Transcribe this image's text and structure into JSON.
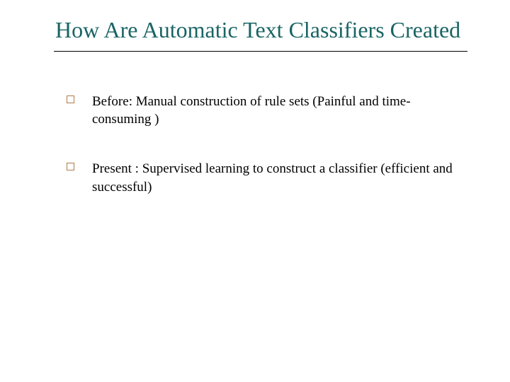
{
  "title": "How Are Automatic Text Classifiers Created",
  "bullets": [
    {
      "text": "Before: Manual construction of rule sets (Painful and time-consuming )"
    },
    {
      "text": "Present : Supervised learning to construct a classifier (efficient and successful)"
    }
  ]
}
